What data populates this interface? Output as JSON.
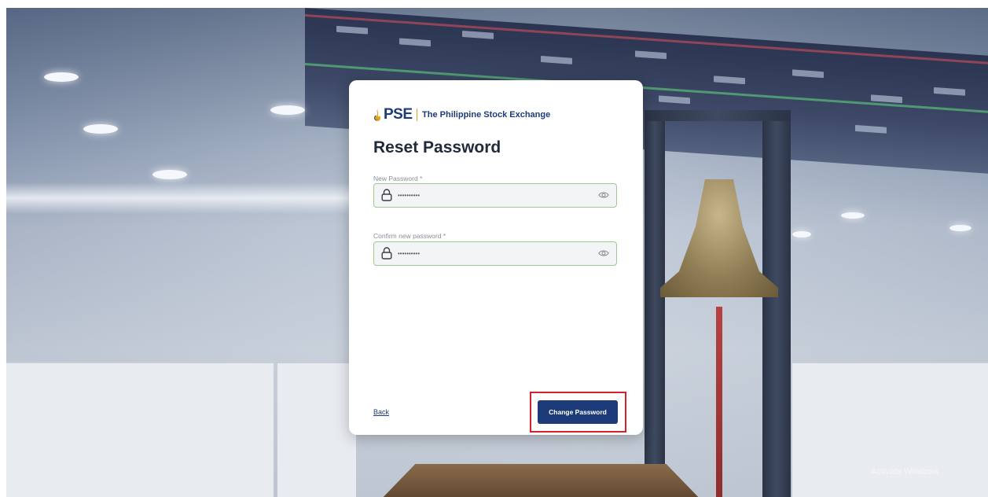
{
  "brand": {
    "logo_text": "PSE",
    "tagline": "The Philippine Stock Exchange",
    "color": "#1d3b78",
    "accent_color": "#e0a21a"
  },
  "form": {
    "title": "Reset Password",
    "new_password": {
      "label": "New Password *",
      "value": "••••••••••",
      "icon_left": "lock-icon",
      "icon_right": "eye-icon"
    },
    "confirm_password": {
      "label": "Confirm new password *",
      "value": "••••••••••",
      "icon_left": "lock-icon",
      "icon_right": "eye-icon"
    },
    "back_label": "Back",
    "submit_label": "Change Password",
    "field_border_color": "#9cc98d",
    "highlight_color": "#d3222a"
  },
  "watermark": "Activate Windows"
}
